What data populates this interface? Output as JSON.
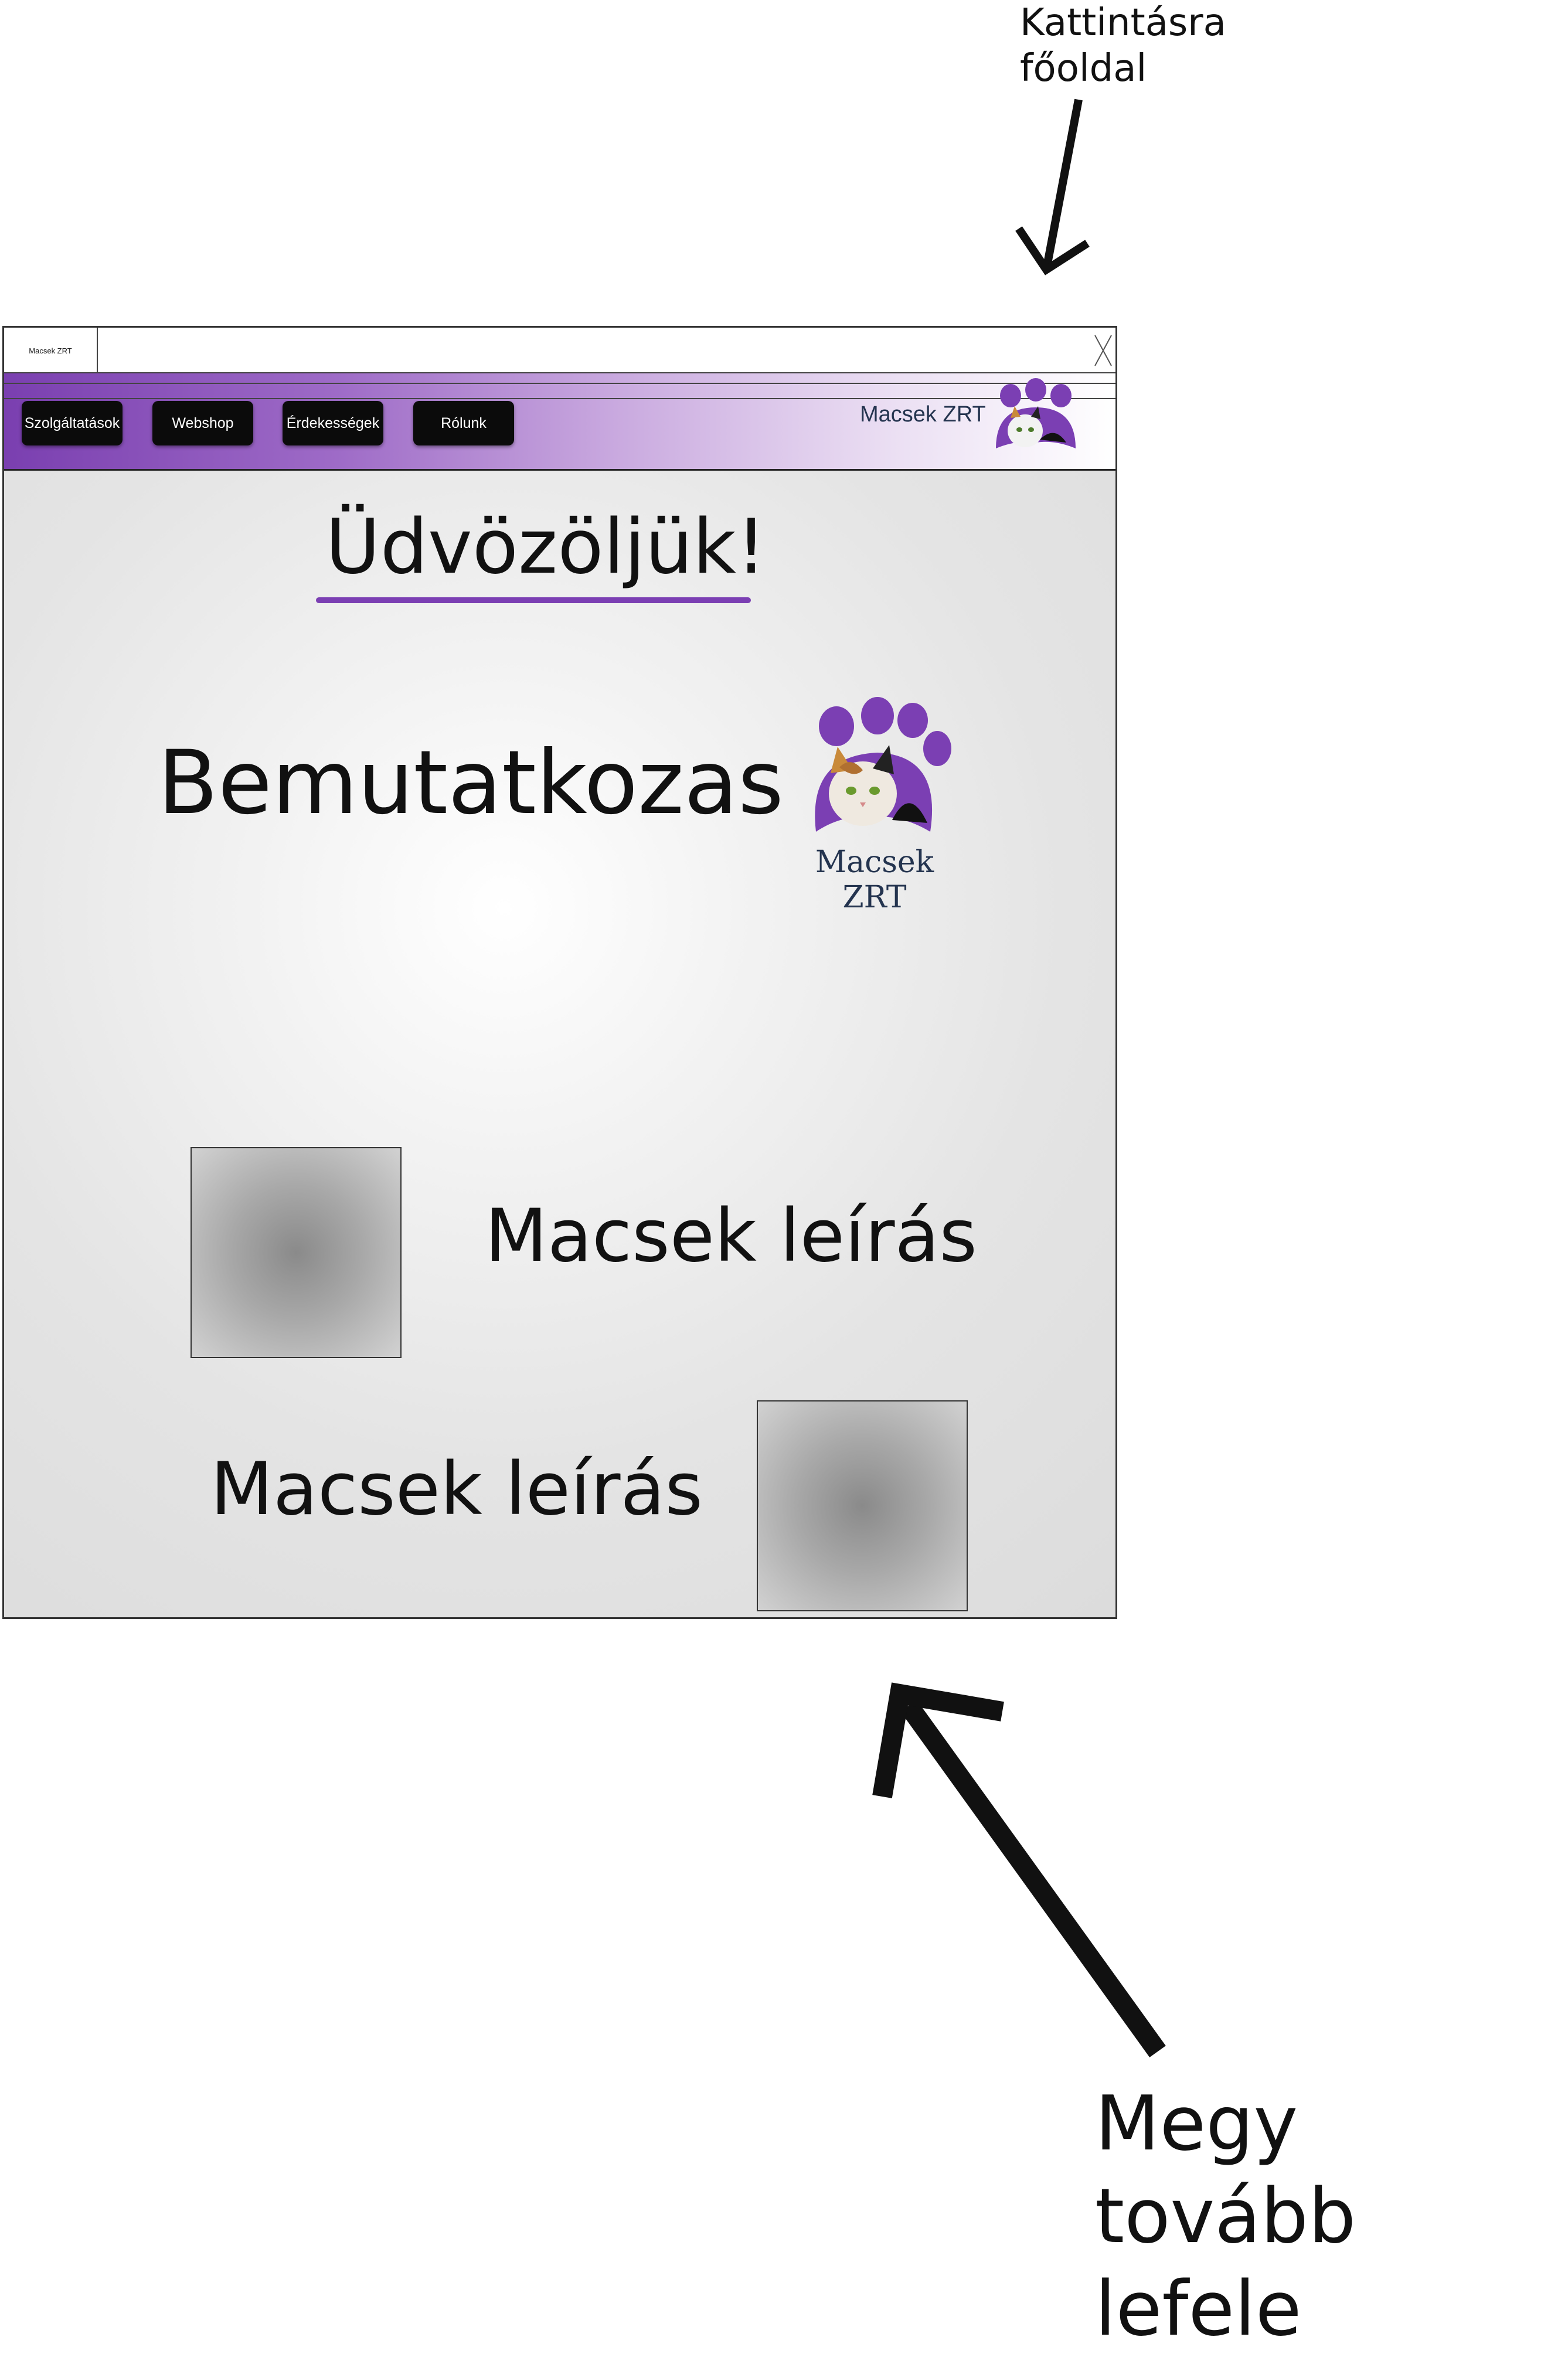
{
  "annotations": {
    "top_note_line1": "Kattintásra",
    "top_note_line2": "főoldal",
    "bottom_note_line1": "Megy tovább",
    "bottom_note_line2": "lefele"
  },
  "browser": {
    "tab_title": "Macsek ZRT",
    "close_icon": "x-icon"
  },
  "navbar": {
    "buttons": [
      {
        "label": "Szolgáltatások"
      },
      {
        "label": "Webshop"
      },
      {
        "label": "Érdekességek"
      },
      {
        "label": "Rólunk"
      }
    ],
    "brand": "Macsek ZRT",
    "logo_icon": "cat-paw-logo-icon",
    "accent_color": "#7b3fb3"
  },
  "main": {
    "welcome": "Üdvözöljük!",
    "intro": "Bemutatkozas",
    "logo_caption": "Macsek ZRT",
    "cards": [
      {
        "description": "Macsek leírás",
        "image_icon": "image-placeholder-icon"
      },
      {
        "description": "Macsek leírás",
        "image_icon": "image-placeholder-icon"
      }
    ]
  }
}
